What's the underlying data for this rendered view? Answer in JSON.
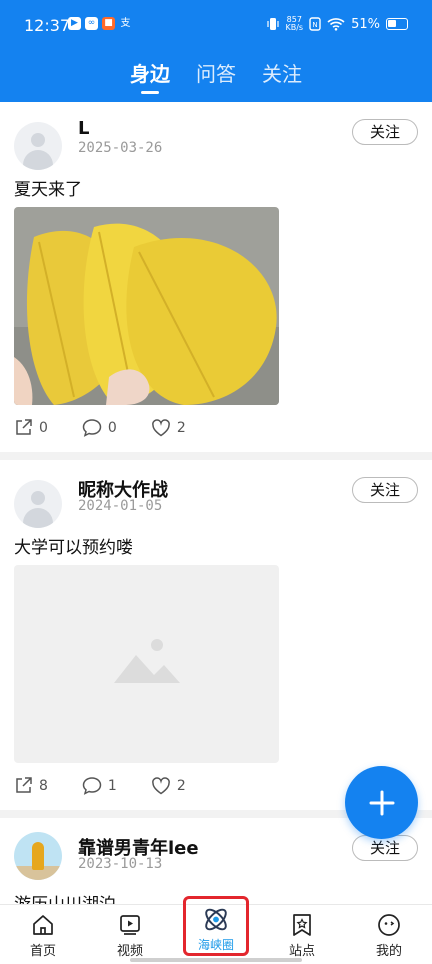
{
  "status_bar": {
    "time": "12:37",
    "speed_top": "857",
    "speed_bottom": "KB/s",
    "battery": "51%"
  },
  "tabs": [
    {
      "label": "身边",
      "active": true
    },
    {
      "label": "问答",
      "active": false
    },
    {
      "label": "关注",
      "active": false
    }
  ],
  "posts": [
    {
      "username": "L",
      "date": "2025-03-26",
      "follow_label": "关注",
      "text": "夏天来了",
      "image": "yellow-leaves-photo",
      "shares": "0",
      "comments": "0",
      "likes": "2"
    },
    {
      "username": "昵称大作战",
      "date": "2024-01-05",
      "follow_label": "关注",
      "text": "大学可以预约喽",
      "image": "image-placeholder-icon",
      "shares": "8",
      "comments": "1",
      "likes": "2"
    },
    {
      "username": "靠谱男青年lee",
      "date": "2023-10-13",
      "follow_label": "关注",
      "text": "游历山川湖泊"
    }
  ],
  "bottom_nav": [
    {
      "label": "首页",
      "icon": "home-icon"
    },
    {
      "label": "视频",
      "icon": "video-icon"
    },
    {
      "label": "海峡圈",
      "icon": "atom-icon",
      "active": true
    },
    {
      "label": "站点",
      "icon": "star-bookmark-icon"
    },
    {
      "label": "我的",
      "icon": "face-icon"
    }
  ],
  "colors": {
    "primary": "#1482f0",
    "active_nav": "#1e9ae8",
    "highlight": "#e3262d"
  }
}
